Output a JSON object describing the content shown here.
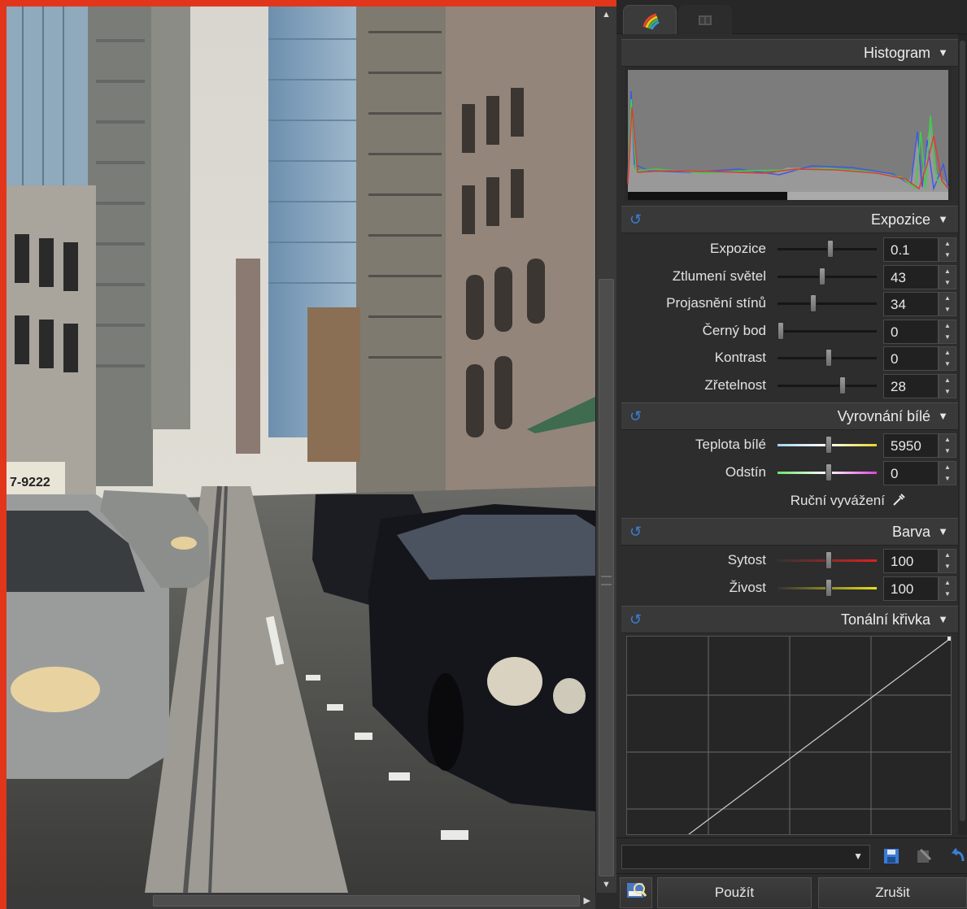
{
  "sections": {
    "histogram": "Histogram",
    "exposure": "Expozice",
    "white_balance": "Vyrovnání bílé",
    "color": "Barva",
    "tone_curve": "Tonální křivka"
  },
  "exposure_rows": [
    {
      "label": "Expozice",
      "value": "0.1",
      "slider_fraction": 0.52
    },
    {
      "label": "Ztlumení světel",
      "value": "43",
      "slider_fraction": 0.43
    },
    {
      "label": "Projasnění stínů",
      "value": "34",
      "slider_fraction": 0.34
    },
    {
      "label": "Černý bod",
      "value": "0",
      "slider_fraction": 0.0
    },
    {
      "label": "Kontrast",
      "value": "0",
      "slider_fraction": 0.5
    },
    {
      "label": "Zřetelnost",
      "value": "28",
      "slider_fraction": 0.64
    }
  ],
  "wb_rows": [
    {
      "label": "Teplota bílé",
      "value": "5950",
      "slider_fraction": 0.5
    },
    {
      "label": "Odstín",
      "value": "0",
      "slider_fraction": 0.5
    }
  ],
  "manual_wb_label": "Ruční vyvážení",
  "color_rows": [
    {
      "label": "Sytost",
      "value": "100",
      "slider_fraction": 0.5
    },
    {
      "label": "Živost",
      "value": "100",
      "slider_fraction": 0.5
    }
  ],
  "buttons": {
    "apply": "Použít",
    "cancel": "Zrušit"
  },
  "photo_sign_text": "7-9222",
  "colors": {
    "frame": "#e2361c",
    "reset_icon": "#3b7fd4",
    "panel_bg": "#2d2d2d"
  }
}
